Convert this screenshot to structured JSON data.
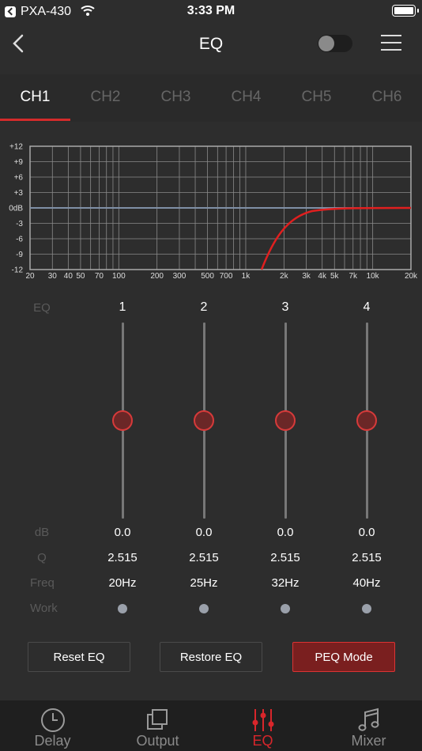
{
  "status": {
    "carrier": "PXA-430",
    "time": "3:33 PM"
  },
  "header": {
    "title": "EQ"
  },
  "tabs": [
    "CH1",
    "CH2",
    "CH3",
    "CH4",
    "CH5",
    "CH6"
  ],
  "graph": {
    "y_ticks": [
      "+12",
      "+9",
      "+6",
      "+3",
      "0dB",
      "-3",
      "-6",
      "-9",
      "-12"
    ],
    "x_ticks": [
      "20",
      "30",
      "40",
      "50",
      "70",
      "100",
      "200",
      "300",
      "500",
      "700",
      "1k",
      "2k",
      "3k",
      "4k",
      "5k",
      "7k",
      "10k",
      "20k"
    ]
  },
  "rows": {
    "eq": "EQ",
    "db": "dB",
    "q": "Q",
    "freq": "Freq",
    "work": "Work"
  },
  "bands": [
    {
      "num": "1",
      "db": "0.0",
      "q": "2.515",
      "freq": "20Hz",
      "level": 0.5
    },
    {
      "num": "2",
      "db": "0.0",
      "q": "2.515",
      "freq": "25Hz",
      "level": 0.5
    },
    {
      "num": "3",
      "db": "0.0",
      "q": "2.515",
      "freq": "32Hz",
      "level": 0.5
    },
    {
      "num": "4",
      "db": "0.0",
      "q": "2.515",
      "freq": "40Hz",
      "level": 0.5
    }
  ],
  "buttons": {
    "reset": "Reset EQ",
    "restore": "Restore EQ",
    "peq": "PEQ Mode"
  },
  "bottom_nav": [
    "Delay",
    "Output",
    "EQ",
    "Mixer"
  ],
  "colors": {
    "accent": "#d8262b",
    "background": "#2d2d2d"
  }
}
